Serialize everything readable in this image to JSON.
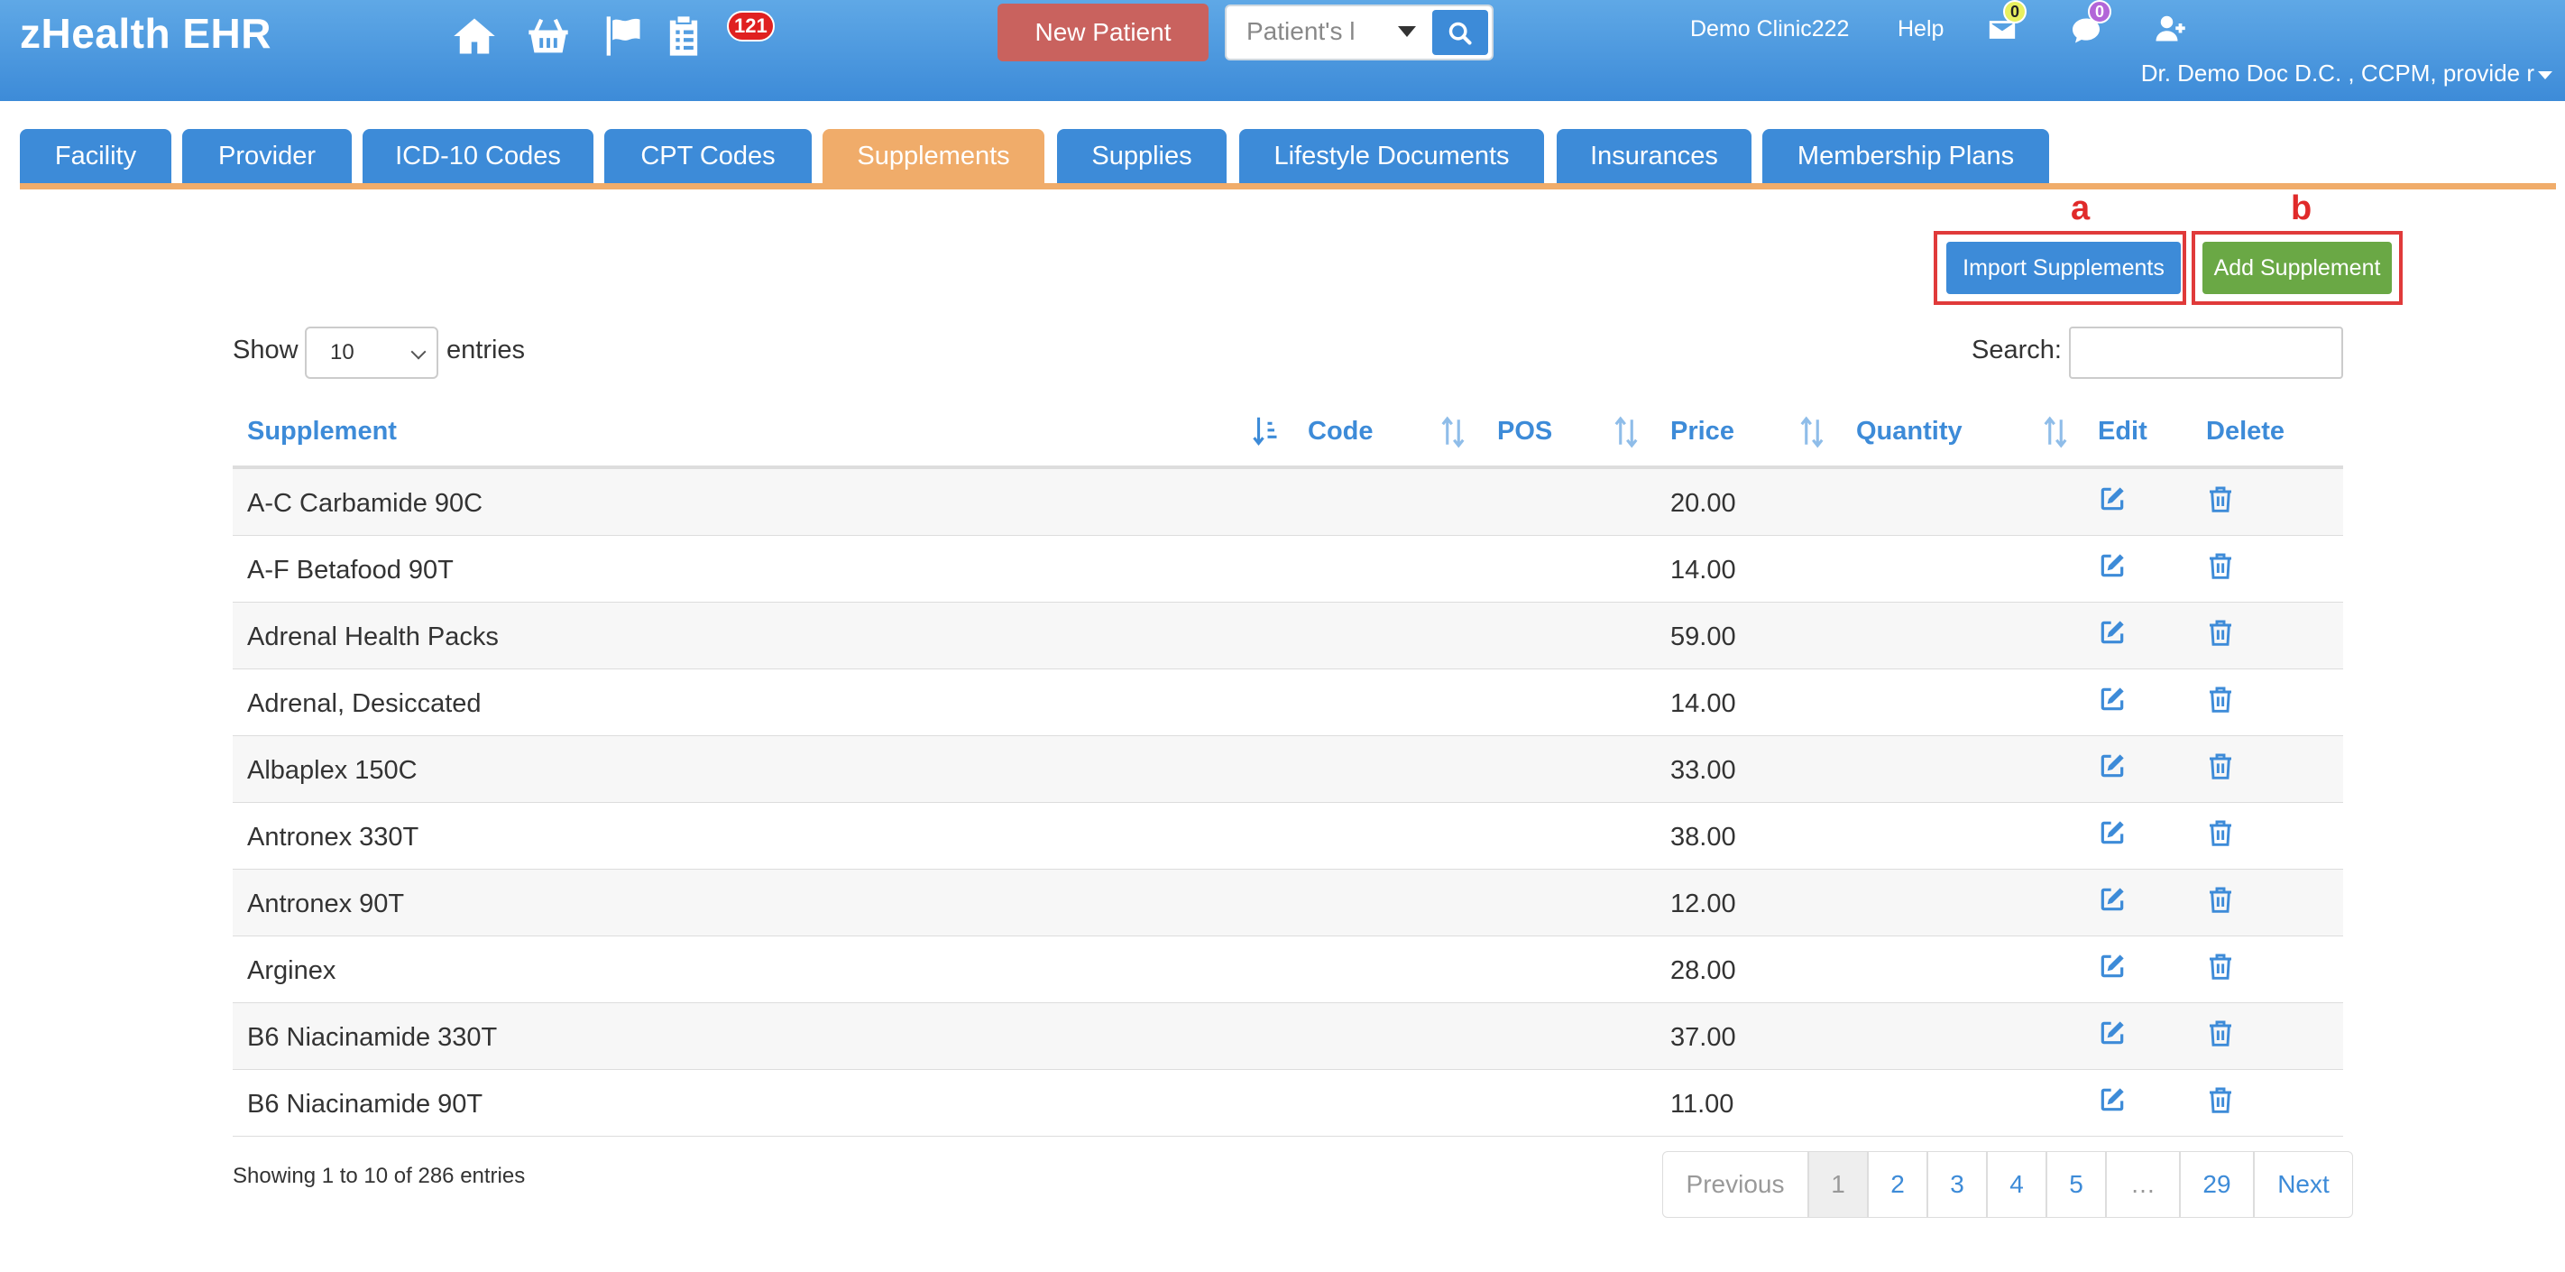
{
  "app": {
    "title": "zHealth EHR"
  },
  "header": {
    "tasks_badge": "121",
    "new_patient_label": "New Patient",
    "patient_search_placeholder": "Patient's l",
    "clinic": "Demo Clinic222",
    "help": "Help",
    "mail_badge": "0",
    "chat_badge": "0",
    "user": "Dr. Demo Doc D.C. , CCPM, provide r",
    "icons": [
      "home-icon",
      "basket-icon",
      "flag-icon",
      "clipboard-icon",
      "envelope-icon",
      "chat-icon",
      "add-user-icon",
      "search-icon"
    ]
  },
  "tabs": [
    {
      "label": "Facility"
    },
    {
      "label": "Provider"
    },
    {
      "label": "ICD-10 Codes"
    },
    {
      "label": "CPT Codes"
    },
    {
      "label": "Supplements",
      "active": true
    },
    {
      "label": "Supplies"
    },
    {
      "label": "Lifestyle Documents"
    },
    {
      "label": "Insurances"
    },
    {
      "label": "Membership Plans"
    }
  ],
  "actions": {
    "import_label": "Import Supplements",
    "import_marker": "a",
    "add_label": "Add Supplement",
    "add_marker": "b"
  },
  "table_controls": {
    "show_label": "Show",
    "page_length": "10",
    "entries_label": "entries",
    "search_label": "Search:"
  },
  "table": {
    "headers": [
      "Supplement",
      "Code",
      "POS",
      "Price",
      "Quantity",
      "Edit",
      "Delete"
    ],
    "rows": [
      {
        "supplement": "A-C Carbamide 90C",
        "price": "20.00"
      },
      {
        "supplement": "A-F Betafood 90T",
        "price": "14.00"
      },
      {
        "supplement": "Adrenal Health Packs",
        "price": "59.00"
      },
      {
        "supplement": "Adrenal, Desiccated",
        "price": "14.00"
      },
      {
        "supplement": "Albaplex 150C",
        "price": "33.00"
      },
      {
        "supplement": "Antronex 330T",
        "price": "38.00"
      },
      {
        "supplement": "Antronex 90T",
        "price": "12.00"
      },
      {
        "supplement": "Arginex",
        "price": "28.00"
      },
      {
        "supplement": "B6 Niacinamide 330T",
        "price": "37.00"
      },
      {
        "supplement": "B6 Niacinamide 90T",
        "price": "11.00"
      }
    ]
  },
  "footer": {
    "info": "Showing 1 to 10 of 286 entries",
    "pagination": [
      "Previous",
      "1",
      "2",
      "3",
      "4",
      "5",
      "…",
      "29",
      "Next"
    ]
  },
  "colors": {
    "primary": "#3d8bd8",
    "active_tab": "#f0ac6a",
    "new_patient": "#c9625e",
    "add_button": "#6aa845",
    "marker": "#e02a2a"
  }
}
